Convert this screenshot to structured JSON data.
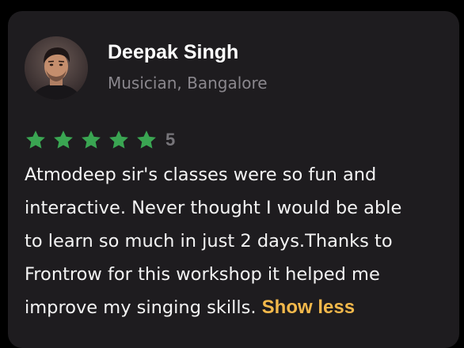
{
  "review": {
    "author_name": "Deepak Singh",
    "author_subtitle": "Musician, Bangalore",
    "rating": 5,
    "rating_label": "5",
    "lines": [
      "Atmodeep sir's classes were so fun and",
      "interactive. Never thought I would be able",
      "to learn so much in just 2 days.Thanks to",
      "Frontrow for this workshop it helped me",
      "improve my singing skills. "
    ],
    "toggle_label": "Show less"
  },
  "colors": {
    "card_background": "#1e1c1f",
    "star": "#3aa552",
    "accent": "#f2b84b",
    "subtitle": "#8a878d"
  },
  "icons": {
    "avatar": "person-avatar-photo",
    "star": "star-icon"
  }
}
